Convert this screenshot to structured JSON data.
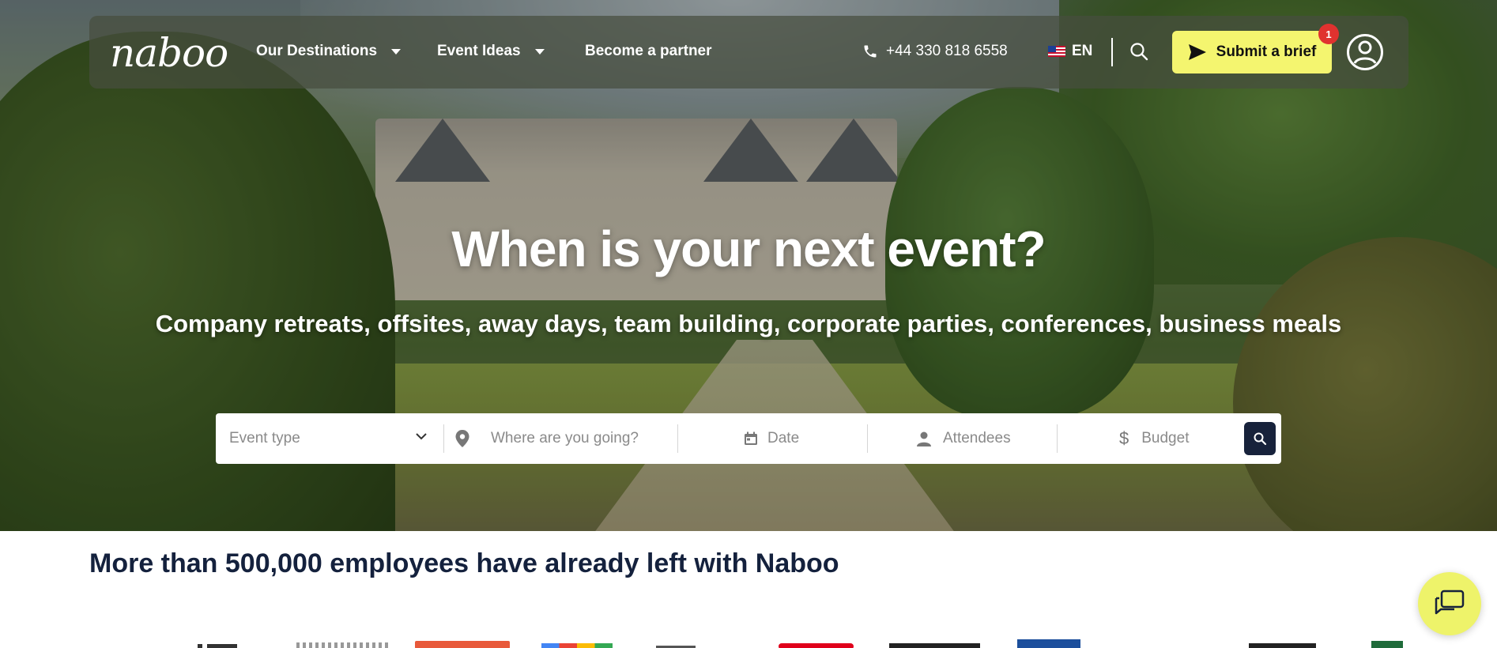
{
  "brand": {
    "logo_text": "naboo"
  },
  "nav": {
    "items": [
      {
        "label": "Our Destinations",
        "has_dropdown": true
      },
      {
        "label": "Event Ideas",
        "has_dropdown": true
      },
      {
        "label": "Become a partner",
        "has_dropdown": false
      }
    ],
    "phone": "+44 330 818 6558",
    "language": "EN",
    "submit_label": "Submit a brief",
    "notification_count": "1"
  },
  "hero": {
    "title": "When is your next event?",
    "subtitle": "Company retreats, offsites, away days, team building, corporate parties, conferences, business meals"
  },
  "search": {
    "event_type_placeholder": "Event type",
    "destination_placeholder": "Where are you going?",
    "date_placeholder": "Date",
    "attendees_placeholder": "Attendees",
    "budget_placeholder": "Budget"
  },
  "social_proof": {
    "heading": "More than 500,000 employees have already left with Naboo"
  },
  "colors": {
    "accent_yellow": "#f4f56f",
    "navy": "#14213d",
    "badge_red": "#e0322f",
    "chat_yellow": "#eef36a"
  },
  "icons": [
    "phone-icon",
    "search-icon",
    "send-icon",
    "account-icon",
    "location-pin-icon",
    "calendar-icon",
    "person-icon",
    "dollar-icon",
    "chevron-down-icon",
    "chat-icon"
  ]
}
